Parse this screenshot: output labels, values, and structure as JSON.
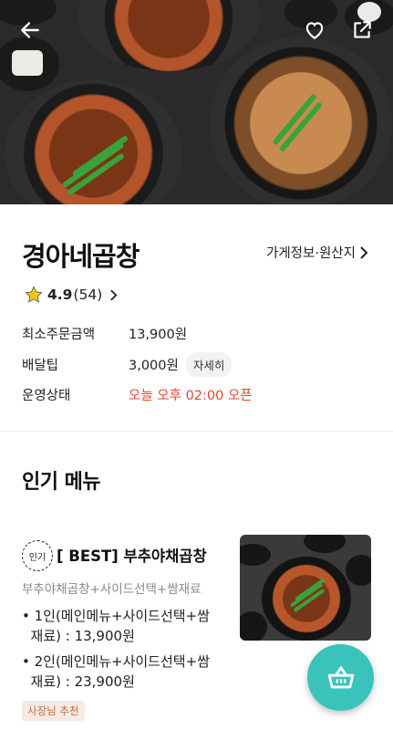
{
  "header": {
    "icons": [
      "back-arrow-icon",
      "heart-icon",
      "share-icon"
    ]
  },
  "store": {
    "name": "경아네곱창",
    "info_link": "가게정보·원산지",
    "rating": "4.9",
    "review_count": "(54)",
    "rows": [
      {
        "label": "최소주문금액",
        "value": "13,900원"
      },
      {
        "label": "배달팁",
        "value": "3,000원",
        "button": "자세히"
      },
      {
        "label": "운영상태",
        "value": "오늘 오후 02:00 오픈"
      }
    ]
  },
  "popular": {
    "title": "인기 메뉴",
    "item": {
      "badge": "인기",
      "name": "[ BEST] 부추야채곱창",
      "description": "부추야채곱창+사이드선택+쌈재료",
      "options": [
        "• 1인(메인메뉴+사이드선택+쌈\n  재료) : 13,900원",
        "• 2인(메인메뉴+사이드선택+쌈\n  재료) : 23,900원"
      ],
      "tag": "사장님 추천"
    }
  },
  "colors": {
    "accent": "#39c3bb",
    "status_red": "#e2442f",
    "tag_text": "#c06a3e",
    "tag_bg": "#f6ebe4"
  }
}
